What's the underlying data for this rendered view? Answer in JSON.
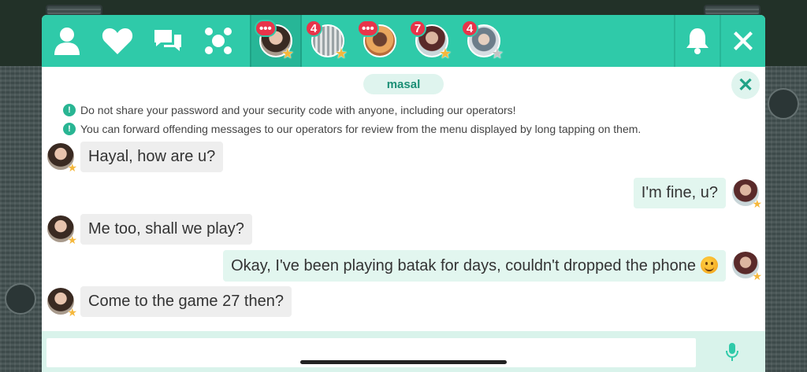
{
  "topbar": {
    "nav_icons": [
      "profile-icon",
      "heart-icon",
      "chat-bubbles-icon",
      "friends-group-icon"
    ],
    "conversations": [
      {
        "badge": "•••",
        "active": true,
        "star": "gold"
      },
      {
        "badge": "4",
        "active": false,
        "star": "gold"
      },
      {
        "badge": "•••",
        "active": false,
        "star": "none"
      },
      {
        "badge": "7",
        "active": false,
        "star": "gold"
      },
      {
        "badge": "4",
        "active": false,
        "star": "grey"
      }
    ],
    "right_icons": [
      "bell-icon",
      "close-icon"
    ]
  },
  "chat": {
    "username": "masal",
    "notices": [
      "Do not share your password and your security code with anyone, including our operators!",
      "You can forward offending messages to our operators for review from the menu displayed by long tapping on them."
    ],
    "messages": [
      {
        "side": "in",
        "text": "Hayal, how are u?"
      },
      {
        "side": "out",
        "text": "I'm fine, u?"
      },
      {
        "side": "in",
        "text": "Me too, shall we play?"
      },
      {
        "side": "out",
        "text": "Okay, I've been playing batak for days, couldn't dropped the phone",
        "emoji": "smiley"
      },
      {
        "side": "in",
        "text": "Come to the game 27 then?"
      }
    ]
  },
  "input": {
    "value": "",
    "placeholder": ""
  },
  "colors": {
    "accent": "#2fcaa9",
    "badge": "#e8344a",
    "bubble_in": "#eeeeee",
    "bubble_out": "#e2f6ef",
    "star": "#f5b83d"
  }
}
